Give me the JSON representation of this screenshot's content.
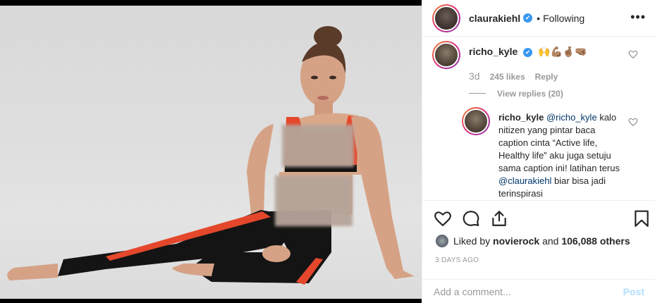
{
  "post": {
    "image_alt": "Woman in athletic wear sitting on studio floor",
    "colors": {
      "legging": "#141414",
      "accent": "#e4472b",
      "skin": "#d9a889"
    }
  },
  "header": {
    "username": "claurakiehl",
    "verified_glyph": "✔",
    "separator": "•",
    "following": "Following",
    "more": "•••"
  },
  "comments": [
    {
      "user": "richo_kyle",
      "text": "🙌💪🏽🤞🏽🤜🏽",
      "time": "3d",
      "likes": "245 likes",
      "reply": "Reply",
      "view_replies": "View replies (20)"
    },
    {
      "user": "richo_kyle",
      "mention1": "@richo_kyle",
      "text1": "kalo nitizen yang pintar baca caption cinta “Active life, Healthy life” aku juga setuju sama caption ini! latihan terus",
      "mention2": "@claurakiehl",
      "text2": "biar bisa jadi terinspirasi"
    }
  ],
  "actions": {
    "likes_prefix": "Liked by",
    "likes_user": "novierock",
    "likes_and": "and",
    "likes_others": "106,088 others",
    "date": "3 DAYS AGO"
  },
  "comment_box": {
    "placeholder": "Add a comment...",
    "post": "Post"
  },
  "icons": [
    "heart-icon",
    "comment-icon",
    "share-icon",
    "bookmark-icon",
    "more-icon",
    "verified-icon"
  ],
  "theme": {
    "link": "#003569",
    "verified": "#3897f0",
    "muted": "#999999",
    "post_disabled": "#b2dffc"
  }
}
